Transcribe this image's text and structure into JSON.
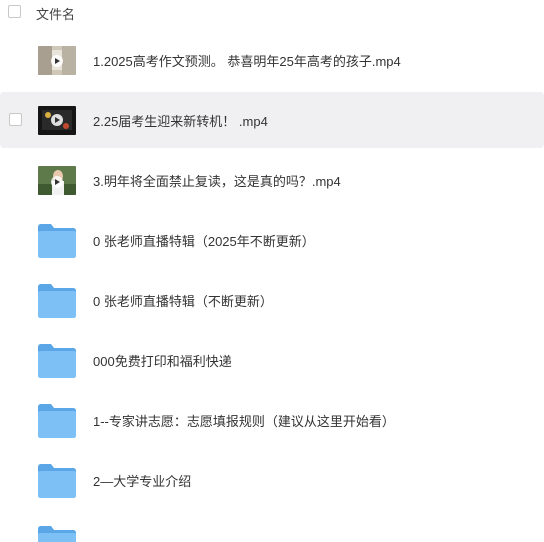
{
  "header": {
    "column_label": "文件名"
  },
  "files": [
    {
      "name": "1.2025高考作文预测。 恭喜明年25年高考的孩子.mp4",
      "type": "video",
      "thumb": "thumb-1"
    },
    {
      "name": "2.25届考生迎来新转机！ .mp4",
      "type": "video",
      "thumb": "thumb-2",
      "hovered": true
    },
    {
      "name": "3.明年将全面禁止复读，这是真的吗？.mp4",
      "type": "video",
      "thumb": "thumb-3"
    },
    {
      "name": "0  张老师直播特辑（2025年不断更新）",
      "type": "folder"
    },
    {
      "name": "0  张老师直播特辑（不断更新）",
      "type": "folder"
    },
    {
      "name": "000免费打印和福利快递",
      "type": "folder"
    },
    {
      "name": "1--专家讲志愿：志愿填报规则（建议从这里开始看）",
      "type": "folder"
    },
    {
      "name": "2—大学专业介绍",
      "type": "folder"
    }
  ],
  "colors": {
    "folder_back": "#5aa6e6",
    "folder_front": "#7cc0f5",
    "hover_bg": "#f0f0f3"
  }
}
